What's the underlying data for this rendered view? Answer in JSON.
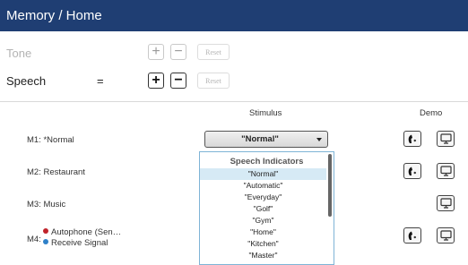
{
  "window": {
    "title": "Memory / Home"
  },
  "tone": {
    "label": "Tone",
    "plus": "+",
    "minus": "−",
    "reset": "Reset"
  },
  "speech": {
    "label": "Speech",
    "equals": "=",
    "plus": "+",
    "minus": "−",
    "reset": "Reset"
  },
  "columns": {
    "stimulus": "Stimulus",
    "demo": "Demo"
  },
  "programs": [
    {
      "label": "M1: *Normal"
    },
    {
      "label": "M2: Restaurant"
    },
    {
      "label": "M3: Music"
    },
    {
      "label": "M4:",
      "items": [
        {
          "text": "Autophone (Sen…",
          "color": "#c0232b"
        },
        {
          "text": "Receive Signal",
          "color": "#2e80c8"
        }
      ]
    }
  ],
  "stimulus_select": {
    "value": "\"Normal\""
  },
  "dropdown": {
    "group": "Speech Indicators",
    "options": [
      "\"Normal\"",
      "\"Automatic\"",
      "\"Everyday\"",
      "\"Golf\"",
      "\"Gym\"",
      "\"Home\"",
      "\"Kitchen\"",
      "\"Master\""
    ],
    "selected_index": 0
  },
  "demo_icons": [
    "ear-icon",
    "monitor-icon"
  ],
  "colors": {
    "title_bar": "#1f3e73",
    "selection": "#d6eaf5",
    "dropdown_border": "#7eb4d6"
  }
}
